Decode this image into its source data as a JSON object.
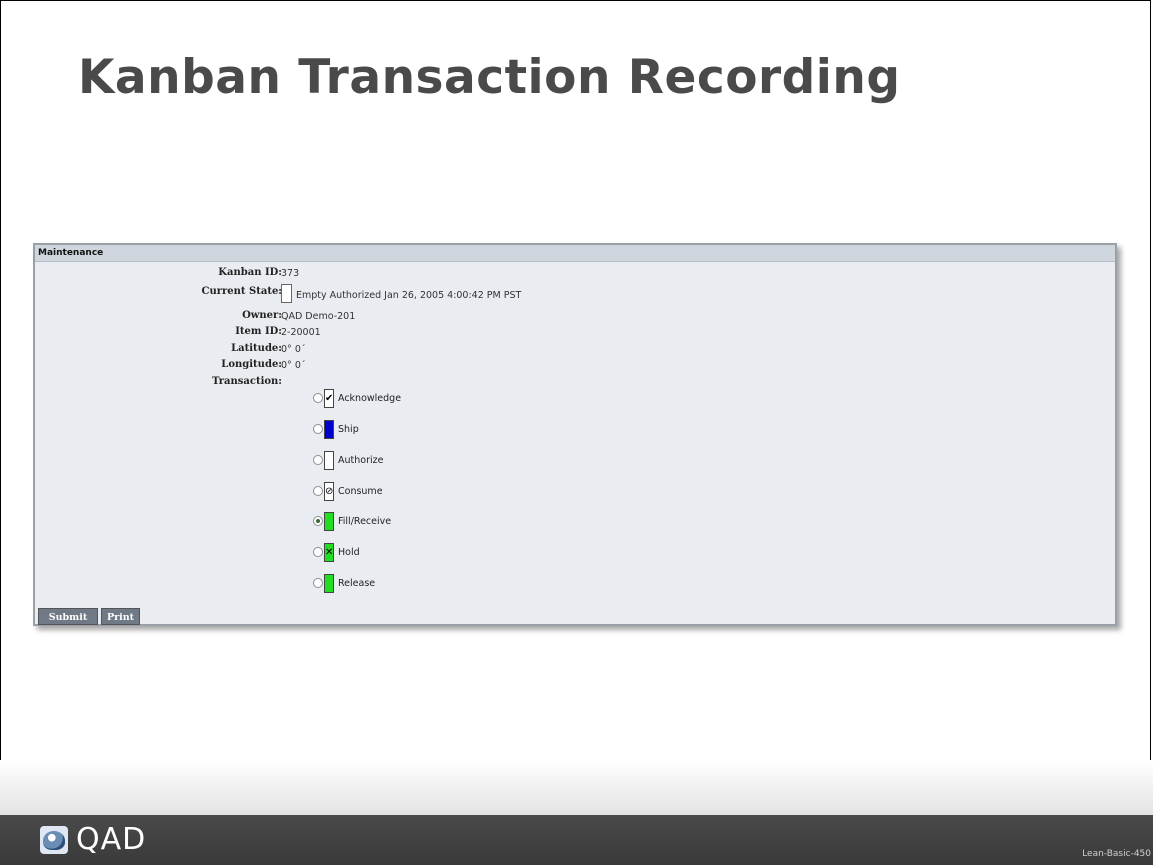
{
  "slide": {
    "title": "Kanban Transaction Recording",
    "footer_logo": "QAD",
    "page_code": "Lean-Basic-450"
  },
  "panel": {
    "header": "Maintenance",
    "fields": {
      "kanban_id_label": "Kanban ID:",
      "kanban_id_value": "373",
      "current_state_label": "Current State:",
      "current_state_value": "Empty Authorized  Jan 26, 2005 4:00:42 PM PST",
      "owner_label": "Owner:",
      "owner_value": "QAD Demo-201",
      "item_id_label": "Item ID:",
      "item_id_value": "2-20001",
      "latitude_label": "Latitude:",
      "latitude_value": "0° 0´",
      "longitude_label": "Longitude:",
      "longitude_value": "0° 0´",
      "transaction_label": "Transaction:"
    },
    "transactions": [
      {
        "label": "Acknowledge",
        "icon": "checkmark-icon",
        "glyph": "✔",
        "color": "#ffffff",
        "selected": false
      },
      {
        "label": "Ship",
        "icon": "blue-square-icon",
        "glyph": "",
        "color": "#0000cc",
        "selected": false
      },
      {
        "label": "Authorize",
        "icon": "empty-square-icon",
        "glyph": "",
        "color": "#ffffff",
        "selected": false
      },
      {
        "label": "Consume",
        "icon": "circle-slash-icon",
        "glyph": "⊘",
        "color": "#ffffff",
        "selected": false
      },
      {
        "label": "Fill/Receive",
        "icon": "green-square-icon",
        "glyph": "",
        "color": "#22dd22",
        "selected": true
      },
      {
        "label": "Hold",
        "icon": "green-x-icon",
        "glyph": "✕",
        "color": "#22dd22",
        "selected": false
      },
      {
        "label": "Release",
        "icon": "green-square-icon",
        "glyph": "",
        "color": "#22dd22",
        "selected": false
      }
    ],
    "buttons": {
      "submit": "Submit",
      "print": "Print"
    }
  }
}
